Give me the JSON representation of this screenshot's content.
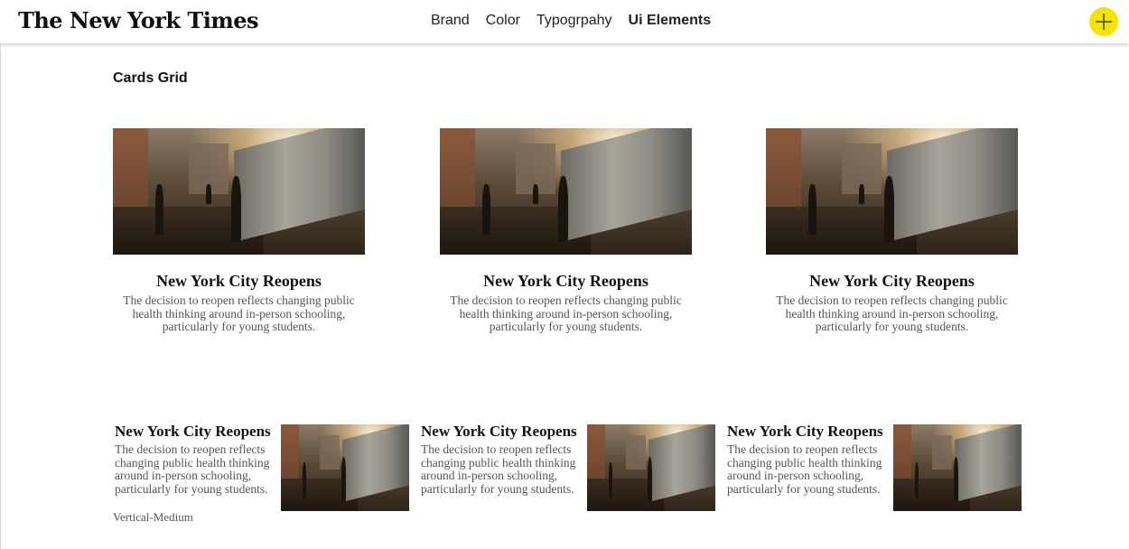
{
  "header": {
    "logo_text": "The New York Times",
    "nav": [
      {
        "label": "Brand",
        "active": false
      },
      {
        "label": "Color",
        "active": false
      },
      {
        "label": "Typogrpahy",
        "active": false
      },
      {
        "label": "Ui Elements",
        "active": true
      }
    ],
    "fab_icon": "plus-icon",
    "fab_color": "#f5e300"
  },
  "main": {
    "section_title": "Cards Grid",
    "large_cards": [
      {
        "headline": "New York City Reopens",
        "summary": "The decision to reopen reflects changing public health thinking around in-person schooling, particularly for young students.",
        "image": "subway-platform-photo"
      },
      {
        "headline": "New York City Reopens",
        "summary": "The decision to reopen reflects changing public health thinking around in-person schooling, particularly for young students.",
        "image": "subway-platform-photo"
      },
      {
        "headline": "New York City Reopens",
        "summary": "The decision to reopen reflects changing public health thinking around in-person schooling, particularly for young students.",
        "image": "subway-platform-photo"
      }
    ],
    "small_cards": [
      {
        "headline": "New York City Reopens",
        "summary": "The decision to reopen reflects changing public health thinking around in-person schooling, particularly for young students.",
        "image": "subway-platform-photo"
      },
      {
        "headline": "New York City Reopens",
        "summary": "The decision to reopen reflects changing public health thinking around in-person schooling, particularly for young students.",
        "image": "subway-platform-photo"
      },
      {
        "headline": "New York City Reopens",
        "summary": "The decision to reopen reflects changing public health thinking around in-person schooling, particularly for young students.",
        "image": "subway-platform-photo"
      }
    ],
    "caption": "Vertical-Medium"
  }
}
